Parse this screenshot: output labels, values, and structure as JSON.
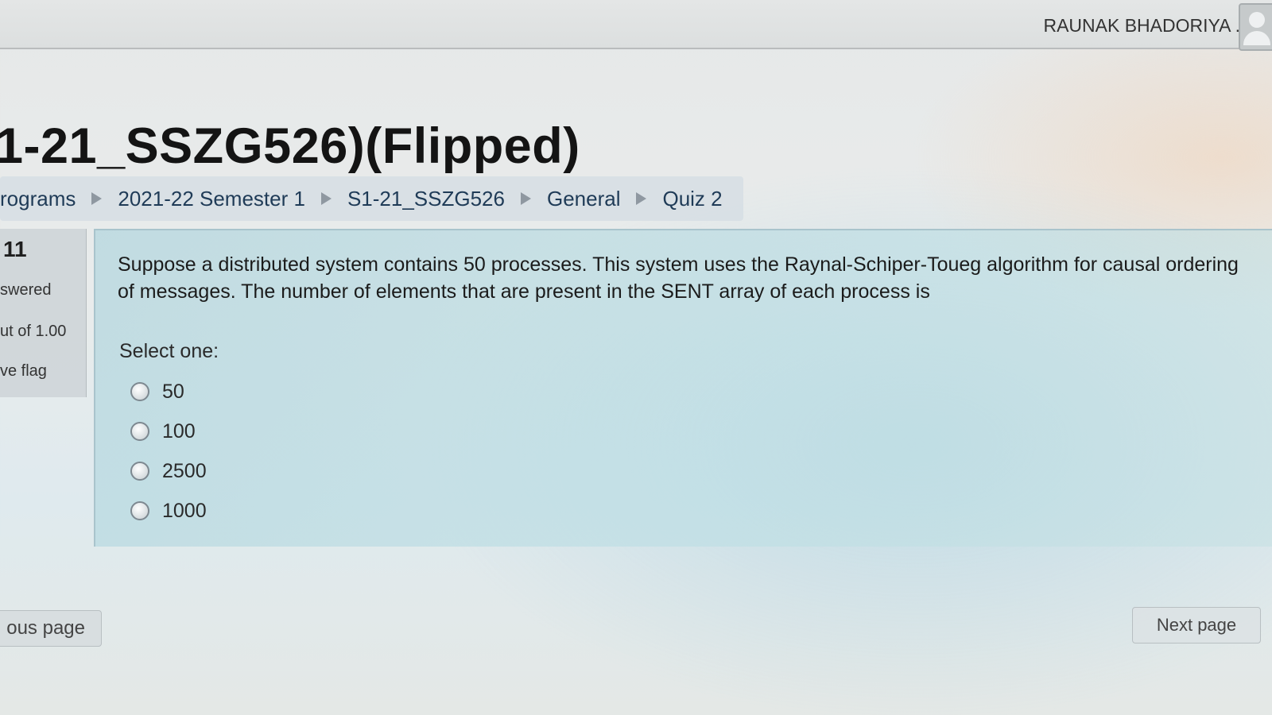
{
  "header": {
    "user_name": "RAUNAK BHADORIYA ."
  },
  "page_title": "1-21_SSZG526)(Flipped)",
  "breadcrumb": [
    "rograms",
    "2021-22 Semester 1",
    "S1-21_SSZG526",
    "General",
    "Quiz 2"
  ],
  "question_info": {
    "number": "11",
    "state": "swered",
    "marks": "ut of 1.00",
    "flag": "ve flag"
  },
  "question": {
    "text": "Suppose a distributed system contains 50 processes. This system uses the Raynal-Schiper-Toueg algorithm for causal ordering of messages. The number of elements that are present in the SENT array of each process is",
    "prompt": "Select one:",
    "options": [
      "50",
      "100",
      "2500",
      "1000"
    ],
    "selected": null
  },
  "navigation": {
    "previous_label": "ous page",
    "next_label": "Next page"
  }
}
